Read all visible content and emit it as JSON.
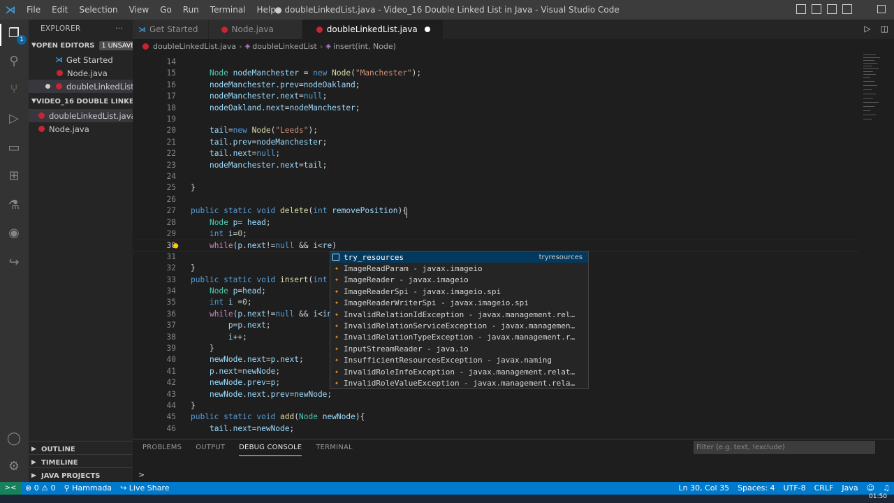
{
  "titlebar": {
    "menu": [
      "File",
      "Edit",
      "Selection",
      "View",
      "Go",
      "Run",
      "Terminal",
      "Help"
    ],
    "title": "● doubleLinkedList.java - Video_16 Double Linked List in Java - Visual Studio Code"
  },
  "activity": {
    "explorer_badge": "1"
  },
  "sidebar": {
    "header": "EXPLORER",
    "more": "···",
    "open_editors": {
      "label": "OPEN EDITORS",
      "badge": "1 UNSAVED"
    },
    "open_items": [
      {
        "label": "Get Started"
      },
      {
        "label": "Node.java"
      },
      {
        "label": "doubleLinkedList..."
      }
    ],
    "folder": {
      "label": "VIDEO_16 DOUBLE LINKED..."
    },
    "folder_items": [
      {
        "label": "doubleLinkedList.java"
      },
      {
        "label": "Node.java"
      }
    ],
    "bottom_sections": [
      "OUTLINE",
      "TIMELINE",
      "JAVA PROJECTS"
    ]
  },
  "tabs": [
    {
      "label": "Get Started"
    },
    {
      "label": "Node.java"
    },
    {
      "label": "doubleLinkedList.java"
    }
  ],
  "breadcrumb": {
    "file": "doubleLinkedList.java",
    "class": "doubleLinkedList",
    "method": "insert(int, Node)"
  },
  "editor": {
    "line_numbers": [
      "14",
      "15",
      "16",
      "17",
      "18",
      "19",
      "20",
      "21",
      "22",
      "23",
      "24",
      "25",
      "26",
      "27",
      "28",
      "29",
      "30",
      "31",
      "32",
      "33",
      "34",
      "35",
      "36",
      "37",
      "38",
      "39",
      "40",
      "41",
      "42",
      "43",
      "44",
      "45",
      "46"
    ],
    "current_line": "30"
  },
  "suggest": {
    "detail": "tryresources",
    "items": [
      "try_resources",
      "ImageReadParam - javax.imageio",
      "ImageReader - javax.imageio",
      "ImageReaderSpi - javax.imageio.spi",
      "ImageReaderWriterSpi - javax.imageio.spi",
      "InvalidRelationIdException - javax.management.rel…",
      "InvalidRelationServiceException - javax.managemen…",
      "InvalidRelationTypeException - javax.management.r…",
      "InputStreamReader - java.io",
      "InsufficientResourcesException - javax.naming",
      "InvalidRoleInfoException - javax.management.relat…",
      "InvalidRoleValueException - javax.management.rela…"
    ]
  },
  "panel": {
    "tabs": [
      "PROBLEMS",
      "OUTPUT",
      "DEBUG CONSOLE",
      "TERMINAL"
    ],
    "active_tab": "DEBUG CONSOLE",
    "filter_placeholder": "Filter (e.g. text, !exclude)",
    "prompt": ">"
  },
  "statusbar": {
    "remote": "><",
    "problems": "⊗ 0  ⚠ 0",
    "user": "Hammada",
    "live_share": "Live Share",
    "position": "Ln 30, Col 35",
    "spaces": "Spaces: 4",
    "encoding": "UTF-8",
    "eol": "CRLF",
    "language": "Java"
  },
  "taskbar": {
    "time": "01:50"
  },
  "colors": {
    "accent": "#007acc",
    "remote": "#16825d",
    "java_icon": "#c82434"
  }
}
